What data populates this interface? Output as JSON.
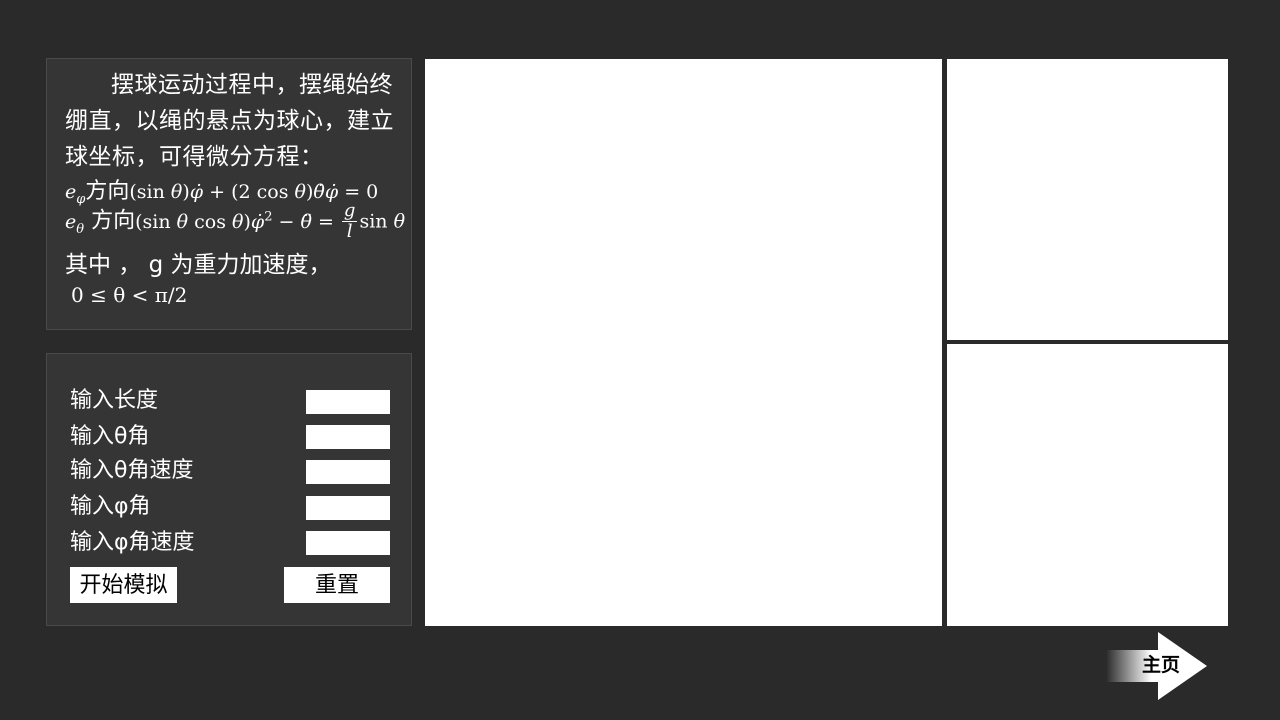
{
  "description": {
    "line1": "摆球运动过程中，摆绳始终",
    "line2": "绷直，以绳的悬点为球心，建立",
    "line3": "球坐标，可得微分方程：",
    "eq1_prefix": "方向",
    "eq2_prefix": "方向",
    "line_where": "其中 ， g 为重力加速度，",
    "range": "0 ≤ θ < π/2"
  },
  "controls": {
    "length_label": "输入长度",
    "theta_label": "输入θ角",
    "theta_speed_label": "输入θ角速度",
    "phi_label": "输入φ角",
    "phi_speed_label": "输入φ角速度",
    "length_value": "",
    "theta_value": "",
    "theta_speed_value": "",
    "phi_value": "",
    "phi_speed_value": "",
    "start_label": "开始模拟",
    "reset_label": "重置"
  },
  "nav": {
    "home_label": "主页"
  }
}
